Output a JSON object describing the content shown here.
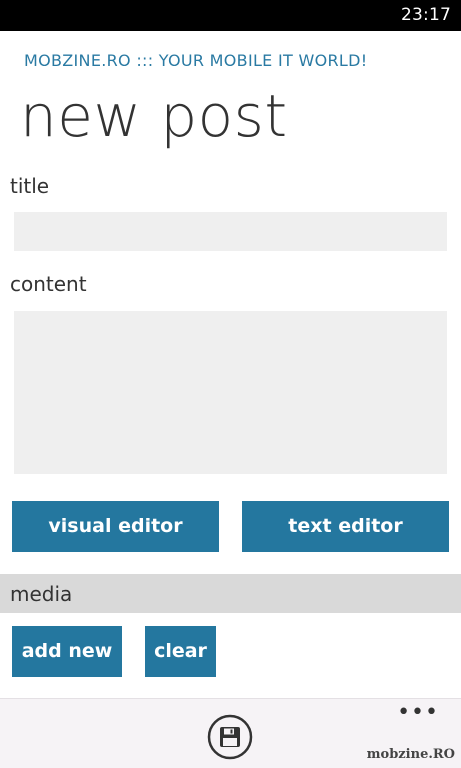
{
  "status_bar": {
    "time": "23:17"
  },
  "header": {
    "app_title": "MOBZINE.RO ::: YOUR MOBILE IT WORLD!",
    "page_title": "new post"
  },
  "form": {
    "title_label": "title",
    "title_value": "",
    "content_label": "content",
    "content_value": ""
  },
  "editor_buttons": {
    "visual_editor": "visual editor",
    "text_editor": "text editor"
  },
  "media": {
    "section_label": "media",
    "add_new": "add new",
    "clear": "clear"
  },
  "app_bar": {
    "save_icon": "save-icon",
    "more_icon": "more-options-icon",
    "more_glyph": "•••"
  },
  "watermark": "mobzine.RO",
  "colors": {
    "accent": "#24779f",
    "app_title": "#2a7aa3",
    "status_bar": "#000000",
    "input_bg": "#efefef",
    "section_header_bg": "#d9d9d9",
    "app_bar_bg": "#f6f3f6"
  }
}
